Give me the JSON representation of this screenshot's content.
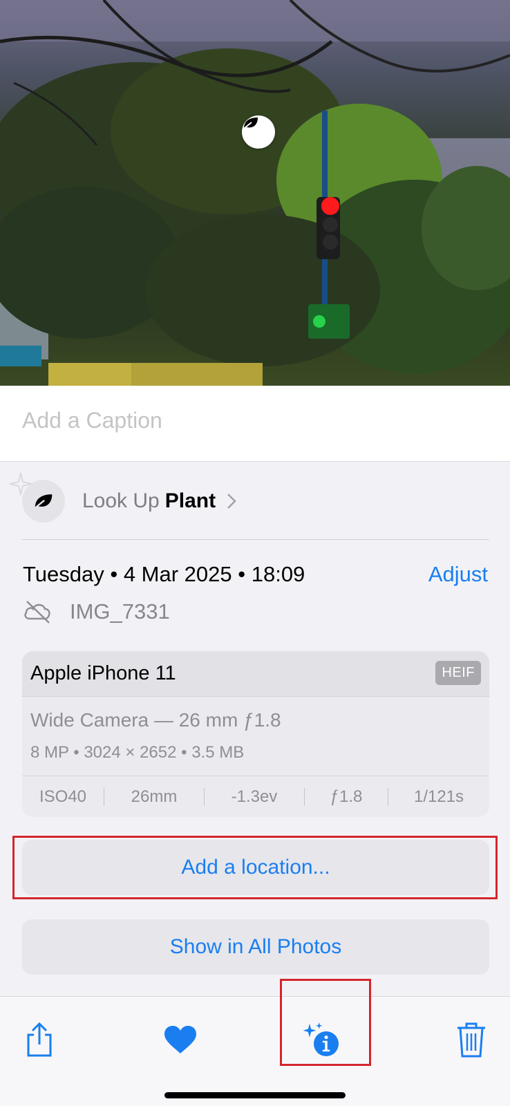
{
  "photo": {
    "visual_lookup_badge_icon": "leaf-icon"
  },
  "caption": {
    "placeholder": "Add a Caption"
  },
  "lookup": {
    "prefix": "Look Up",
    "subject": "Plant",
    "icon": "leaf-icon"
  },
  "info": {
    "date_text": "Tuesday • 4 Mar 2025 • 18:09",
    "adjust_label": "Adjust",
    "file_name": "IMG_7331",
    "cloud_status_icon": "cloud-slash-icon"
  },
  "camera": {
    "device": "Apple iPhone 11",
    "format_badge": "HEIF",
    "lens": "Wide Camera — 26 mm ƒ1.8",
    "specs": "8 MP  •  3024 × 2652  •  3.5 MB",
    "exif": [
      "ISO40",
      "26mm",
      "-1.3ev",
      "ƒ1.8",
      "1/121s"
    ]
  },
  "buttons": {
    "add_location": "Add a location...",
    "show_all": "Show in All Photos"
  },
  "toolbar": {
    "share_icon": "share-icon",
    "favorite_icon": "heart-icon",
    "info_icon": "info-sparkle-icon",
    "delete_icon": "trash-icon"
  },
  "colors": {
    "accent": "#1a7ef0",
    "highlight": "#d4252c"
  }
}
